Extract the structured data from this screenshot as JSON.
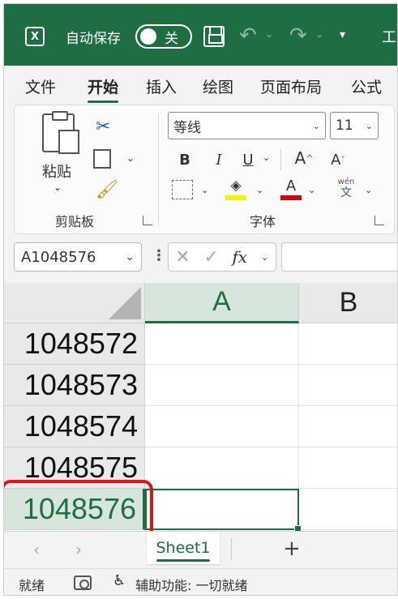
{
  "titlebar": {
    "autosave_label": "自动保存",
    "autosave_state": "关",
    "title_fragment": "工"
  },
  "tabs": [
    "文件",
    "开始",
    "插入",
    "绘图",
    "页面布局",
    "公式"
  ],
  "active_tab": "开始",
  "ribbon": {
    "clipboard": {
      "paste_label": "粘贴",
      "group_label": "剪贴板"
    },
    "font": {
      "font_name": "等线",
      "font_size": "11",
      "bold": "B",
      "italic": "I",
      "underline": "U",
      "grow": "A^",
      "shrink": "Aˇ",
      "font_color_letter": "A",
      "wen_top": "wén",
      "wen_bottom": "文",
      "group_label": "字体",
      "fill_color": "#f5f500",
      "font_color": "#e00000"
    }
  },
  "formula_bar": {
    "name_box": "A1048576",
    "fx": "fx",
    "content": ""
  },
  "grid": {
    "columns": [
      "A",
      "B"
    ],
    "selected_column": "A",
    "rows": [
      "1048572",
      "1048573",
      "1048574",
      "1048575",
      "1048576"
    ],
    "selected_row": "1048576",
    "highlight_color": "#e01616"
  },
  "sheets": {
    "tabs": [
      "Sheet1"
    ],
    "active": "Sheet1",
    "add_label": "+"
  },
  "statusbar": {
    "ready": "就绪",
    "accessibility": "辅助功能: 一切就绪"
  },
  "colors": {
    "brand": "#1f6e43"
  }
}
